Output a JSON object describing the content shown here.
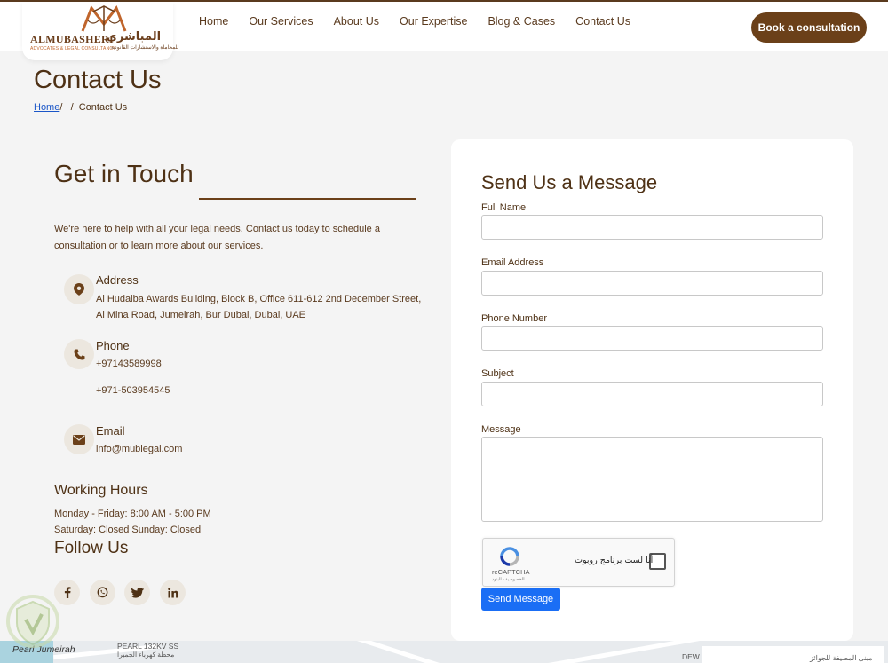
{
  "header": {
    "logo": {
      "name_en": "ALMUBASHERI",
      "name_ar": "المباشري",
      "tagline_en": "ADVOCATES & LEGAL CONSULTANCY",
      "tagline_ar": "للمحاماة والاستشارات القانونية"
    },
    "nav": [
      {
        "label": "Home"
      },
      {
        "label": "Our Services"
      },
      {
        "label": "About Us"
      },
      {
        "label": "Our Expertise"
      },
      {
        "label": "Blog & Cases"
      },
      {
        "label": "Contact Us"
      }
    ],
    "cta_label": "Book a consultation"
  },
  "page": {
    "title": "Contact Us",
    "breadcrumb": {
      "home": "Home",
      "separator": "/   /",
      "current": "Contact Us"
    }
  },
  "get_in_touch": {
    "title": "Get in Touch",
    "intro": "We're here to help with all your legal needs. Contact us today to schedule a consultation or to learn more about our services.",
    "address": {
      "label": "Address",
      "line1": "Al Hudaiba Awards Building, Block B, Office 611-612 2nd December Street,",
      "line2": "Al Mina Road, Jumeirah, Bur Dubai, Dubai, UAE",
      "icon": "location-pin-icon"
    },
    "phone": {
      "label": "Phone",
      "number1": "+97143589998",
      "number2": "+971-503954545",
      "icon": "phone-icon"
    },
    "email": {
      "label": "Email",
      "address": "info@mublegal.com",
      "icon": "envelope-icon"
    },
    "working_hours": {
      "title": "Working Hours",
      "line1": "Monday - Friday: 8:00 AM - 5:00 PM",
      "line2": "Saturday: Closed Sunday: Closed"
    },
    "follow": {
      "title": "Follow Us",
      "icons": [
        "facebook-icon",
        "whatsapp-icon",
        "twitter-icon",
        "linkedin-icon"
      ]
    }
  },
  "form": {
    "title": "Send Us a Message",
    "fields": {
      "full_name": {
        "label": "Full Name",
        "value": ""
      },
      "email": {
        "label": "Email Address",
        "value": ""
      },
      "phone": {
        "label": "Phone Number",
        "value": ""
      },
      "subject": {
        "label": "Subject",
        "value": ""
      },
      "message": {
        "label": "Message",
        "value": ""
      }
    },
    "recaptcha": {
      "text": "أنا لست برنامج روبوت",
      "brand": "reCAPTCHA",
      "footer": "الخصوصية - البنود"
    },
    "submit_label": "Send Message"
  },
  "map": {
    "label_place": "Pearl Jumeirah",
    "label_station": "PEARL 132KV SS",
    "label_station_ar": "محطة كهرباء الجميرا",
    "label_dew": "DEW",
    "label_box": "مبنى المضيفة للجوائز"
  },
  "colors": {
    "brand_brown": "#6b4019",
    "text_brown": "#4e3115",
    "button_blue": "#1a6ef5"
  }
}
